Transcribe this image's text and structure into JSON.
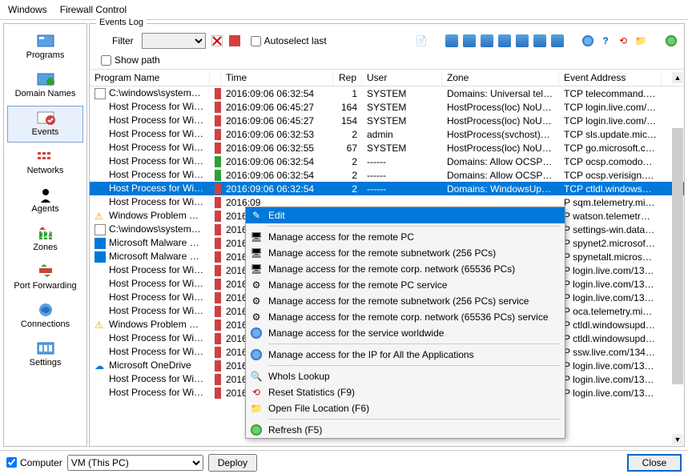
{
  "title": {
    "app": "Windows",
    "sub": "Firewall Control"
  },
  "sidebar": {
    "items": [
      {
        "label": "Programs"
      },
      {
        "label": "Domain Names"
      },
      {
        "label": "Events"
      },
      {
        "label": "Networks"
      },
      {
        "label": "Agents"
      },
      {
        "label": "Zones"
      },
      {
        "label": "Port Forwarding"
      },
      {
        "label": "Connections"
      },
      {
        "label": "Settings"
      }
    ]
  },
  "events": {
    "fieldset_label": "Events Log",
    "filter_label": "Filter",
    "autoselect_label": "Autoselect last",
    "showpath_label": "Show path"
  },
  "cols": {
    "prog": "Program Name",
    "time": "Time",
    "rep": "Rep",
    "user": "User",
    "zone": "Zone",
    "addr": "Event Address"
  },
  "rows": [
    {
      "icon": "exe",
      "prog": "C:\\windows\\system…",
      "dir": "out",
      "time": "2016:09:06 06:32:54",
      "rep": "1",
      "user": "SYSTEM",
      "zone": "Domains: Universal tel…",
      "addr": "TCP telecommand.tel…"
    },
    {
      "icon": "hatch",
      "prog": "Host Process for Wi…",
      "dir": "out",
      "time": "2016:09:06 06:45:27",
      "rep": "164",
      "user": "SYSTEM",
      "zone": "HostProcess(loc) NoUp…",
      "addr": "TCP login.live.com/13…"
    },
    {
      "icon": "hatch",
      "prog": "Host Process for Wi…",
      "dir": "out",
      "time": "2016:09:06 06:45:27",
      "rep": "154",
      "user": "SYSTEM",
      "zone": "HostProcess(loc) NoUp…",
      "addr": "TCP login.live.com/13…"
    },
    {
      "icon": "hatch",
      "prog": "Host Process for Wi…",
      "dir": "out",
      "time": "2016:09:06 06:32:53",
      "rep": "2",
      "user": "admin",
      "zone": "HostProcess(svchost)…",
      "addr": "TCP sls.update.micros…"
    },
    {
      "icon": "hatch",
      "prog": "Host Process for Wi…",
      "dir": "out",
      "time": "2016:09:06 06:32:55",
      "rep": "67",
      "user": "SYSTEM",
      "zone": "HostProcess(loc) NoUp…",
      "addr": "TCP go.microsoft.com…"
    },
    {
      "icon": "hatch",
      "prog": "Host Process for Wi…",
      "dir": "in",
      "time": "2016:09:06 06:32:54",
      "rep": "2",
      "user": "------",
      "zone": "Domains: Allow OCSPs…",
      "addr": "TCP ocsp.comodoca.c…"
    },
    {
      "icon": "hatch",
      "prog": "Host Process for Wi…",
      "dir": "in",
      "time": "2016:09:06 06:32:54",
      "rep": "2",
      "user": "------",
      "zone": "Domains: Allow OCSPs…",
      "addr": "TCP ocsp.verisign.co…"
    },
    {
      "icon": "hatch",
      "prog": "Host Process for Wi…",
      "dir": "out",
      "time": "2016:09:06 06:32:54",
      "rep": "2",
      "user": "------",
      "zone": "Domains: WindowsUpd…",
      "addr": "TCP ctldl.windowsupd…",
      "sel": true
    },
    {
      "icon": "hatch",
      "prog": "Host Process for Wi…",
      "dir": "out",
      "time": "2016:09",
      "rep": "",
      "user": "",
      "zone": "",
      "addr": "P sqm.telemetry.mi…"
    },
    {
      "icon": "warn",
      "prog": "Windows Problem R…",
      "dir": "out",
      "time": "2016:09",
      "rep": "",
      "user": "",
      "zone": "",
      "addr": "P watson.telemetr…"
    },
    {
      "icon": "exe",
      "prog": "C:\\windows\\system…",
      "dir": "out",
      "time": "2016:09",
      "rep": "",
      "user": "",
      "zone": "",
      "addr": "P settings-win.data…"
    },
    {
      "icon": "ms",
      "prog": "Microsoft Malware P…",
      "dir": "out",
      "time": "2016:09",
      "rep": "",
      "user": "",
      "zone": "",
      "addr": "P spynet2.microsof…"
    },
    {
      "icon": "ms",
      "prog": "Microsoft Malware P…",
      "dir": "out",
      "time": "2016:09",
      "rep": "",
      "user": "",
      "zone": "",
      "addr": "P spynetalt.micros…"
    },
    {
      "icon": "hatch",
      "prog": "Host Process for Wi…",
      "dir": "out",
      "time": "2016:09",
      "rep": "",
      "user": "",
      "zone": "",
      "addr": "P login.live.com/13…"
    },
    {
      "icon": "hatch",
      "prog": "Host Process for Wi…",
      "dir": "out",
      "time": "2016:09",
      "rep": "",
      "user": "",
      "zone": "",
      "addr": "P login.live.com/13…"
    },
    {
      "icon": "hatch",
      "prog": "Host Process for Wi…",
      "dir": "out",
      "time": "2016:09",
      "rep": "",
      "user": "",
      "zone": "",
      "addr": "P login.live.com/13…"
    },
    {
      "icon": "hatch",
      "prog": "Host Process for Wi…",
      "dir": "out",
      "time": "2016:09",
      "rep": "",
      "user": "",
      "zone": "",
      "addr": "P oca.telemetry.mi…"
    },
    {
      "icon": "warn",
      "prog": "Windows Problem R…",
      "dir": "out",
      "time": "2016:09",
      "rep": "",
      "user": "",
      "zone": "",
      "addr": "P ctldl.windowsupd…"
    },
    {
      "icon": "hatch",
      "prog": "Host Process for Wi…",
      "dir": "out",
      "time": "2016:09",
      "rep": "",
      "user": "",
      "zone": "",
      "addr": "P ctldl.windowsupd…"
    },
    {
      "icon": "hatch",
      "prog": "Host Process for Wi…",
      "dir": "out",
      "time": "2016:09",
      "rep": "",
      "user": "",
      "zone": "",
      "addr": "P ssw.live.com/134…"
    },
    {
      "icon": "od",
      "prog": "Microsoft OneDrive",
      "dir": "out",
      "time": "2016:09",
      "rep": "",
      "user": "",
      "zone": "",
      "addr": "P login.live.com/13…"
    },
    {
      "icon": "hatch",
      "prog": "Host Process for Wi…",
      "dir": "out",
      "time": "2016:09",
      "rep": "",
      "user": "",
      "zone": "",
      "addr": "P login.live.com/13…"
    },
    {
      "icon": "hatch",
      "prog": "Host Process for Wi…",
      "dir": "out",
      "time": "2016:09",
      "rep": "",
      "user": "",
      "zone": "",
      "addr": "P login.live.com/13…"
    }
  ],
  "menu": {
    "items": [
      {
        "icon": "edit",
        "label": "Edit",
        "sel": true
      },
      {
        "sep": true
      },
      {
        "icon": "pc",
        "label": "Manage access for the remote PC"
      },
      {
        "icon": "pcs",
        "label": "Manage access for the remote subnetwork (256 PCs)"
      },
      {
        "icon": "pcs",
        "label": "Manage access for the remote corp. network (65536 PCs)"
      },
      {
        "icon": "svc",
        "label": "Manage access for the remote PC service"
      },
      {
        "icon": "svcs",
        "label": "Manage access for the remote subnetwork (256 PCs) service"
      },
      {
        "icon": "svcs",
        "label": "Manage access for the remote corp. network (65536 PCs) service"
      },
      {
        "icon": "globe",
        "label": "Manage access for the service worldwide"
      },
      {
        "sep": true
      },
      {
        "icon": "globe",
        "label": "Manage access for the IP for All the Applications"
      },
      {
        "sep": true
      },
      {
        "icon": "whois",
        "label": "WhoIs Lookup"
      },
      {
        "icon": "reset",
        "label": "Reset Statistics (F9)"
      },
      {
        "icon": "folder",
        "label": "Open File Location (F6)"
      },
      {
        "sep": true
      },
      {
        "icon": "refresh",
        "label": "Refresh (F5)"
      }
    ]
  },
  "footer": {
    "computer_label": "Computer",
    "computer_value": "VM (This PC)",
    "deploy": "Deploy",
    "close": "Close"
  }
}
